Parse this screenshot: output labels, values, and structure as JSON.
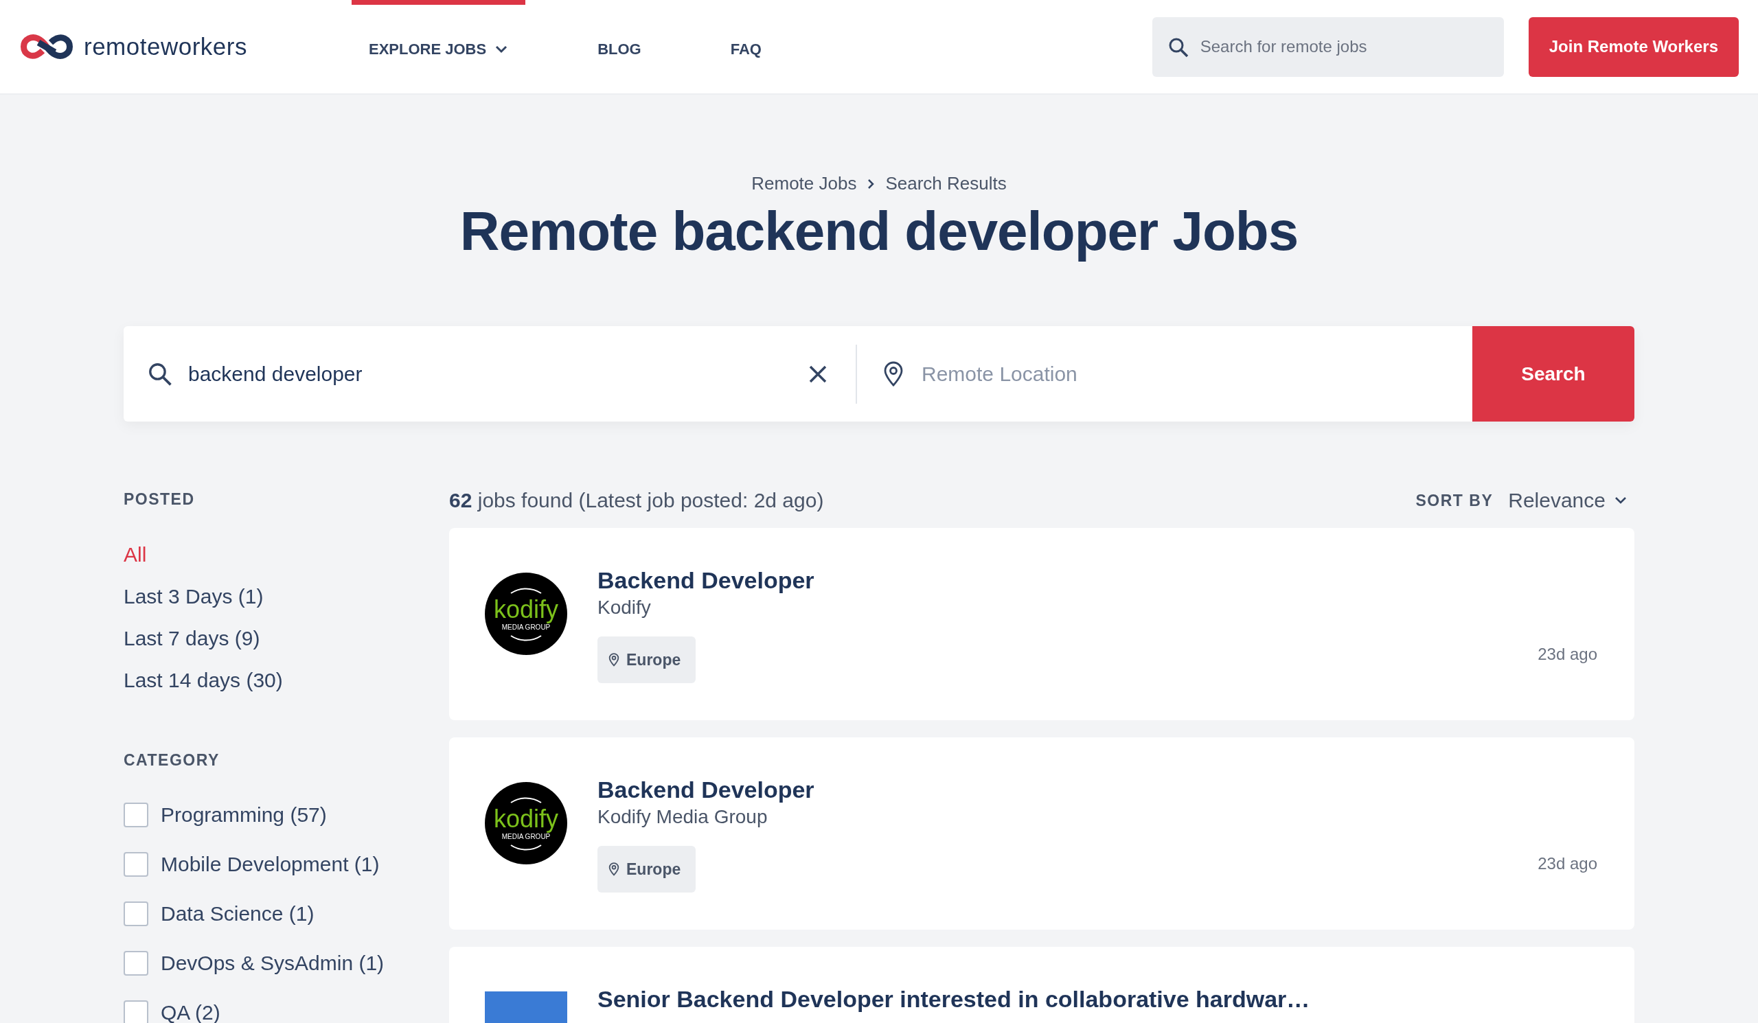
{
  "header": {
    "logo": "remoteworkers",
    "nav": [
      {
        "label": "EXPLORE JOBS",
        "selected": true,
        "dropdown": true
      },
      {
        "label": "BLOG",
        "selected": false,
        "dropdown": false
      },
      {
        "label": "FAQ",
        "selected": false,
        "dropdown": false
      }
    ],
    "search": {
      "placeholder": "Search for remote jobs"
    },
    "join_button": "Join Remote Workers"
  },
  "breadcrumb": [
    "Remote Jobs",
    "Search Results"
  ],
  "title": "Remote backend developer Jobs",
  "search_bar": {
    "query": "backend developer",
    "location_placeholder": "Remote Location",
    "button": "Search"
  },
  "filters": {
    "posted": {
      "heading": "POSTED",
      "options": [
        {
          "label": "All",
          "selected": true
        },
        {
          "label": "Last 3 Days (1)",
          "selected": false
        },
        {
          "label": "Last 7 days (9)",
          "selected": false
        },
        {
          "label": "Last 14 days (30)",
          "selected": false
        }
      ]
    },
    "category": {
      "heading": "CATEGORY",
      "options": [
        {
          "label": "Programming (57)",
          "checked": false
        },
        {
          "label": "Mobile Development (1)",
          "checked": false
        },
        {
          "label": "Data Science (1)",
          "checked": false
        },
        {
          "label": "DevOps & SysAdmin (1)",
          "checked": false
        },
        {
          "label": "QA (2)",
          "checked": false
        }
      ]
    }
  },
  "results": {
    "summary": "**62** jobs found (Latest job posted: 2d ago)",
    "sort_label": "SORT BY",
    "sort_value": "Relevance"
  },
  "jobs": [
    {
      "kind": "kodify",
      "title": "Backend Developer",
      "company": "Kodify",
      "logo_text": "kodify",
      "logo_subtext": "MEDIA GROUP",
      "location": "Europe",
      "posted": "23d ago"
    },
    {
      "kind": "kodify",
      "title": "Backend Developer",
      "company": "Kodify Media Group",
      "logo_text": "kodify",
      "logo_subtext": "MEDIA GROUP",
      "location": "Europe",
      "posted": "23d ago"
    },
    {
      "kind": "plain",
      "title": "Senior Backend Developer interested in collaborative hardwar…",
      "color": "#3a7bd5"
    }
  ]
}
